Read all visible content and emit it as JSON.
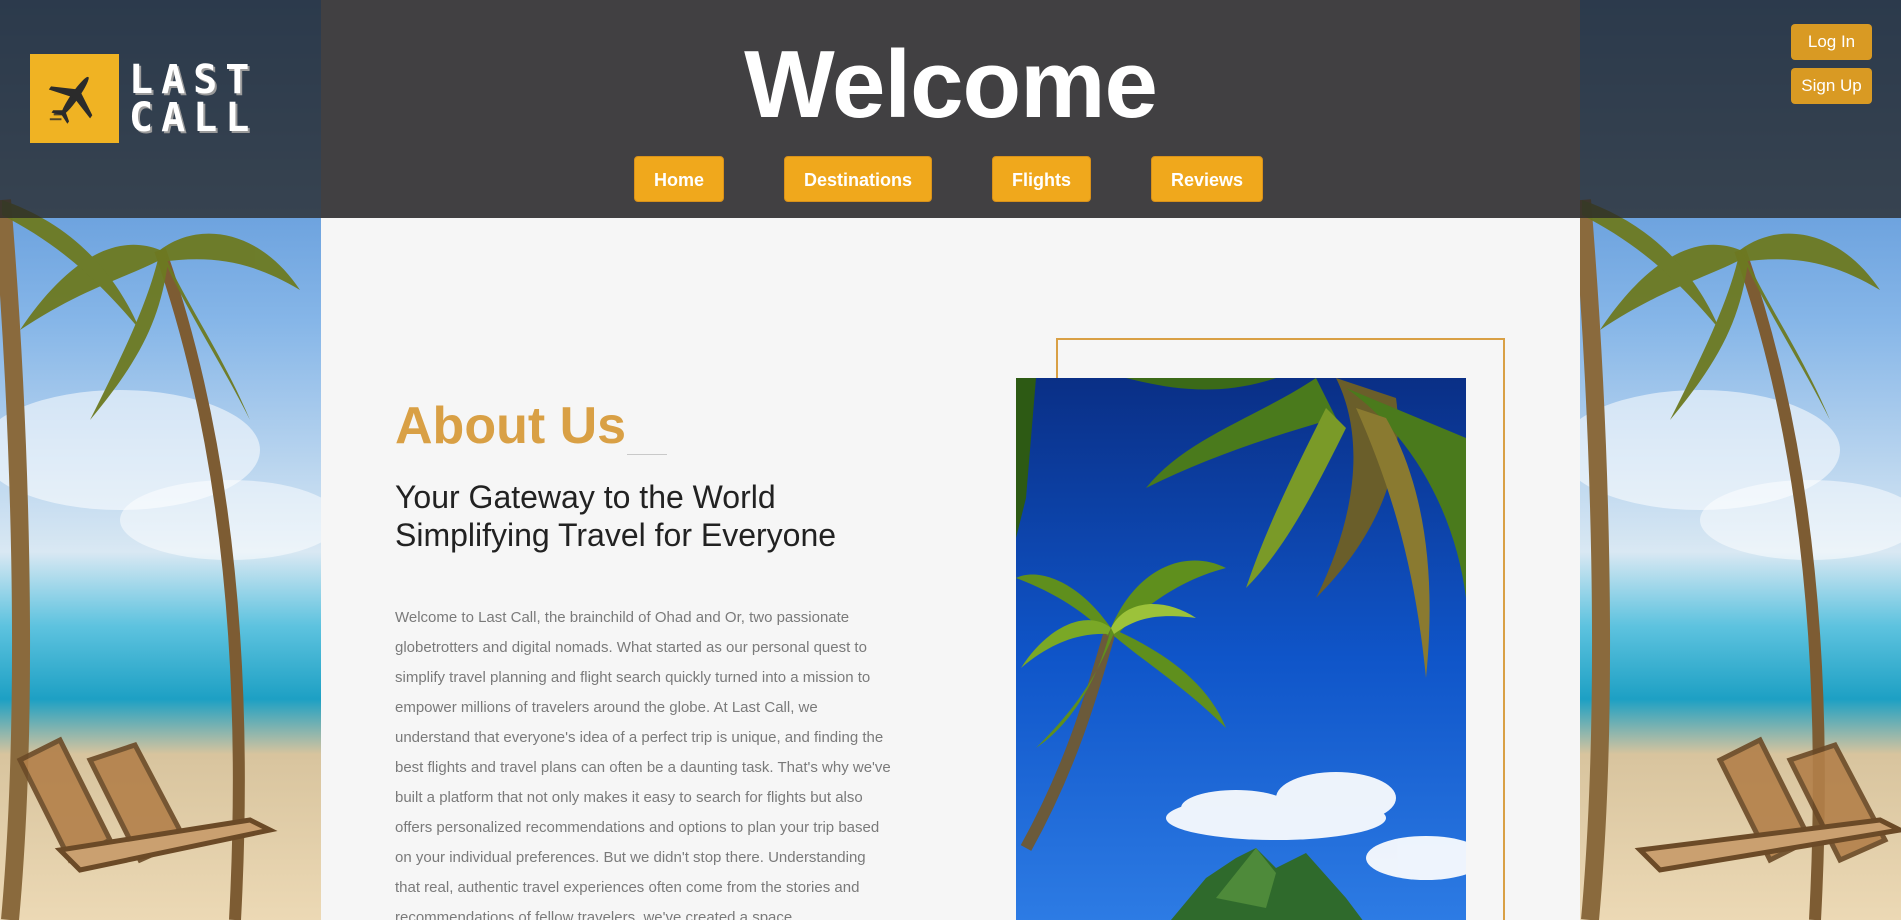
{
  "header": {
    "logo": {
      "line1": "LAST",
      "line2": "CALL",
      "icon": "airplane-icon"
    },
    "title": "Welcome",
    "nav": [
      {
        "label": "Home"
      },
      {
        "label": "Destinations"
      },
      {
        "label": "Flights"
      },
      {
        "label": "Reviews"
      }
    ],
    "auth": {
      "login": "Log In",
      "signup": "Sign Up"
    }
  },
  "about": {
    "title": "About Us",
    "subtitle_line1": "Your Gateway to the World",
    "subtitle_line2": "Simplifying Travel for Everyone",
    "body": "Welcome to Last Call, the brainchild of Ohad and Or, two passionate globetrotters and digital nomads. What started as our personal quest to simplify travel planning and flight search quickly turned into a mission to empower millions of travelers around the globe. At Last Call, we understand that everyone's idea of a perfect trip is unique, and finding the best flights and travel plans can often be a daunting task. That's why we've built a platform that not only makes it easy to search for flights but also offers personalized recommendations and options to plan your trip based on your individual preferences. But we didn't stop there. Understanding that real, authentic travel experiences often come from the stories and recommendations of fellow travelers, we've created a space"
  },
  "colors": {
    "accent": "#f0a81c",
    "logo_yellow": "#f0b323",
    "about_gold": "#d9a045",
    "header_bg": "#414042",
    "content_bg": "#f6f6f6"
  }
}
